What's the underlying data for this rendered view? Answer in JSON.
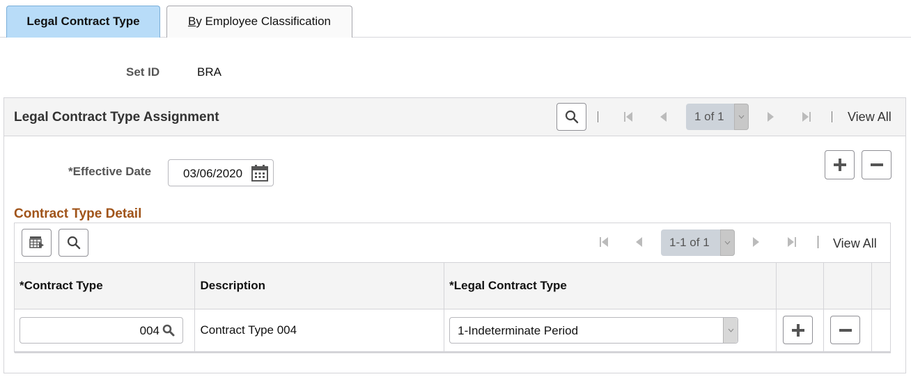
{
  "tabs": [
    {
      "label": "Legal Contract Type",
      "active": true
    },
    {
      "accesskey": "B",
      "label_rest": "y Employee Classification",
      "active": false
    }
  ],
  "setid": {
    "label": "Set ID",
    "value": "BRA"
  },
  "panel": {
    "title": "Legal Contract Type Assignment",
    "pager": "1 of 1",
    "view_all": "View All",
    "effective_date_label": "*Effective Date",
    "effective_date_value": "03/06/2020"
  },
  "grid": {
    "title": "Contract Type Detail",
    "pager": "1-1 of 1",
    "view_all": "View All",
    "columns": [
      "*Contract Type",
      "Description",
      "*Legal Contract Type",
      "",
      "",
      ""
    ],
    "rows": [
      {
        "contract_type": "004",
        "description": "Contract Type 004",
        "legal_contract_type": "1-Indeterminate Period"
      }
    ]
  },
  "icons": {
    "search": "search-icon",
    "first": "first-page-icon",
    "prev": "previous-icon",
    "next": "next-icon",
    "last": "last-page-icon",
    "calendar": "calendar-icon",
    "add": "plus-icon",
    "delete": "minus-icon",
    "personalize": "grid-personalize-icon",
    "dropdown": "chevron-down-icon"
  },
  "colors": {
    "active_tab": "#b8dcf8",
    "grid_title": "#a0541a",
    "header_bg": "#f4f4f4",
    "pager_bg": "#cdd3da"
  }
}
